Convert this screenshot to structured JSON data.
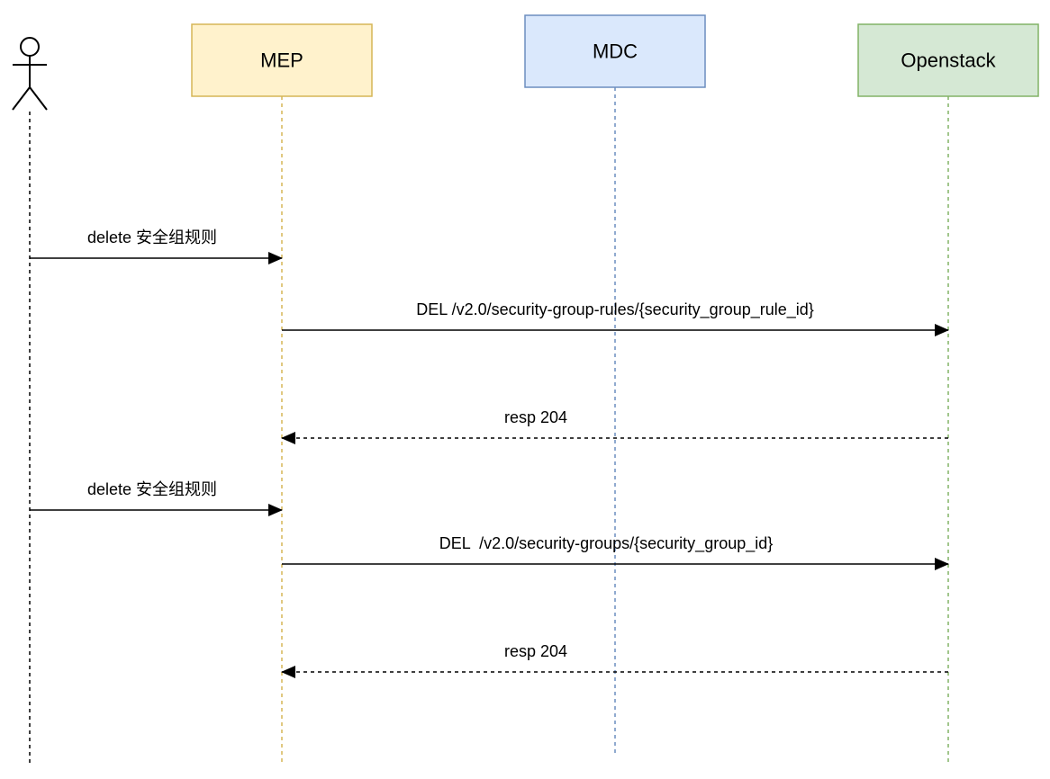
{
  "participants": {
    "actor": {
      "name": ""
    },
    "mep": {
      "label": "MEP",
      "fill": "#fff2cc",
      "stroke": "#d6b656"
    },
    "mdc": {
      "label": "MDC",
      "fill": "#dae8fc",
      "stroke": "#6c8ebf"
    },
    "openstack": {
      "label": "Openstack",
      "fill": "#d5e8d4",
      "stroke": "#82b366"
    }
  },
  "messages": [
    {
      "label": "delete 安全组规则",
      "from": "actor",
      "to": "mep",
      "style": "solid"
    },
    {
      "label": "DEL /v2.0/security-group-rules/{security_group_rule_id}",
      "from": "mep",
      "to": "openstack",
      "style": "solid"
    },
    {
      "label": "resp 204",
      "from": "openstack",
      "to": "mep",
      "style": "dashed"
    },
    {
      "label": "delete 安全组规则",
      "from": "actor",
      "to": "mep",
      "style": "solid"
    },
    {
      "label": "DEL  /v2.0/security-groups/{security_group_id}",
      "from": "mep",
      "to": "openstack",
      "style": "solid"
    },
    {
      "label": "resp 204",
      "from": "openstack",
      "to": "mep",
      "style": "dashed"
    }
  ]
}
